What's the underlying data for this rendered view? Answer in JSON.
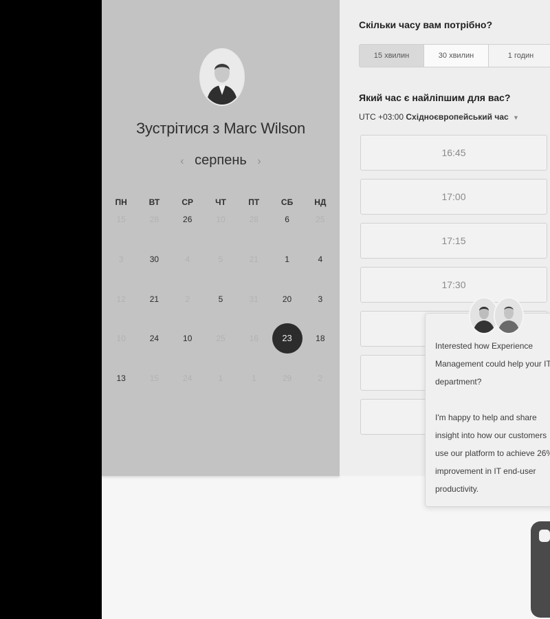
{
  "scheduler": {
    "meet_title": "Зустрітися з Marc Wilson",
    "month": "серпень",
    "prev_arrow": "‹",
    "next_arrow": "›",
    "weekdays": [
      "ПН",
      "ВТ",
      "СР",
      "ЧТ",
      "ПТ",
      "СБ",
      "НД"
    ],
    "weeks": [
      [
        "15",
        "28",
        "26",
        "10",
        "28",
        "6",
        "25"
      ],
      [
        "3",
        "30",
        "4",
        "5",
        "21",
        "1",
        "4"
      ],
      [
        "12",
        "21",
        "2",
        "5",
        "31",
        "20",
        "3"
      ],
      [
        "10",
        "24",
        "10",
        "25",
        "16",
        "23",
        "18"
      ],
      [
        "13",
        "15",
        "24",
        "1",
        "1",
        "29",
        "2"
      ]
    ],
    "selected_day": "23",
    "duration_question": "Скільки часу вам потрібно?",
    "durations": [
      "15 хвилин",
      "30 хвилин",
      "1 годин"
    ],
    "time_question": "Який час є найліпшим для вас?",
    "timezone_offset": "UTC +03:00",
    "timezone_name": "Східноєвропейський час",
    "time_slots": [
      "16:45",
      "17:00",
      "17:15",
      "17:30",
      "",
      "",
      "",
      ""
    ]
  },
  "chat": {
    "line1": "Interested how Experience",
    "line2": "Management could help your IT",
    "line3": "department?",
    "line4": "I'm happy to help and share",
    "line5": "insight into how our customers",
    "line6": "use our platform to achieve 26%",
    "line7": "improvement in IT end-user",
    "line8": "productivity."
  },
  "colors": {
    "left_panel_bg": "#c3c3c3",
    "right_panel_bg": "#eeeeee",
    "selected_day_bg": "#2c2c2c",
    "page_bg": "#f6f6f6"
  }
}
